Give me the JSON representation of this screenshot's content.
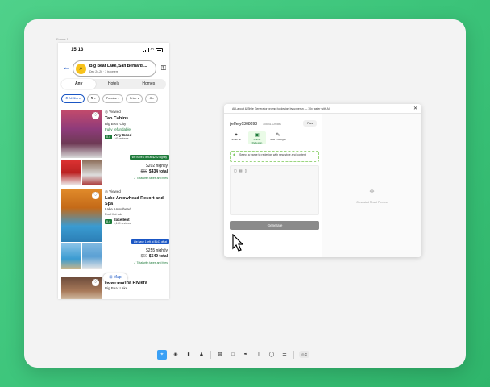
{
  "canvas": {
    "frame_label": "Frame 1"
  },
  "phone": {
    "status_time": "15:13",
    "search": {
      "destination": "Big Bear Lake, San Bernardi...",
      "dates": "Dec 24-26",
      "travelers": "3 travelers"
    },
    "tabs": [
      "Any",
      "Hotels",
      "Homes"
    ],
    "filters": [
      "All filters",
      "",
      "Popular",
      "Price",
      "Gu"
    ],
    "listings": [
      {
        "viewed": "Viewed",
        "name": "Tao Cabins",
        "location": "Big Bear City",
        "refundable": "Fully refundable",
        "rating_score": "8.4",
        "rating_text": "Very Good",
        "reviews": "140 reviews",
        "amenities": "",
        "promo": "We have 2 left at $202 nightly",
        "nightly": "$202 nightly",
        "old_total": "$69",
        "total": "$434 total",
        "taxes": "Total with taxes and fees"
      },
      {
        "viewed": "Viewed",
        "name": "Lake Arrowhead Resort and Spa",
        "location": "Lake Arrowhead",
        "refundable": "",
        "rating_score": "8.4",
        "rating_text": "Excellent",
        "reviews": "1,139 reviews",
        "amenities": "Pool  Hot tub",
        "promo": "We have 1 left at $147 off at",
        "nightly": "$255 nightly",
        "old_total": "$69",
        "total": "$549 total",
        "taxes": "Total with taxes and fees"
      },
      {
        "viewed": "",
        "name": "Hotel Marina Riviera",
        "location": "Big Bear Lake",
        "refundable": "",
        "rating_score": "",
        "rating_text": "",
        "reviews": "",
        "amenities": "",
        "promo": "",
        "nightly": "",
        "old_total": "",
        "total": "",
        "taxes": ""
      }
    ],
    "map_button": "Map"
  },
  "plugin": {
    "title": "AI Layout & Style Generator prompt to design by uxpersn — 10x faster with AI",
    "username": "jeffery0308098",
    "credits": "105.41 Credits",
    "plus_label": "Plus",
    "modes": [
      {
        "icon": "sparkle",
        "label": "Smart fill"
      },
      {
        "icon": "image",
        "label": "Frame Redesign"
      },
      {
        "icon": "paint",
        "label": "New Prototype"
      }
    ],
    "hint": "Select a frame to redesign with new style and content",
    "generate_label": "Generate",
    "right_placeholder": "Generated Result Preview"
  },
  "colors": {
    "background": "#3cc47a",
    "accent_green": "#1e7a3a",
    "accent_blue": "#1a56c4",
    "generate_button": "#8a8a8a",
    "toolbar_selected": "#3aa0f5"
  }
}
